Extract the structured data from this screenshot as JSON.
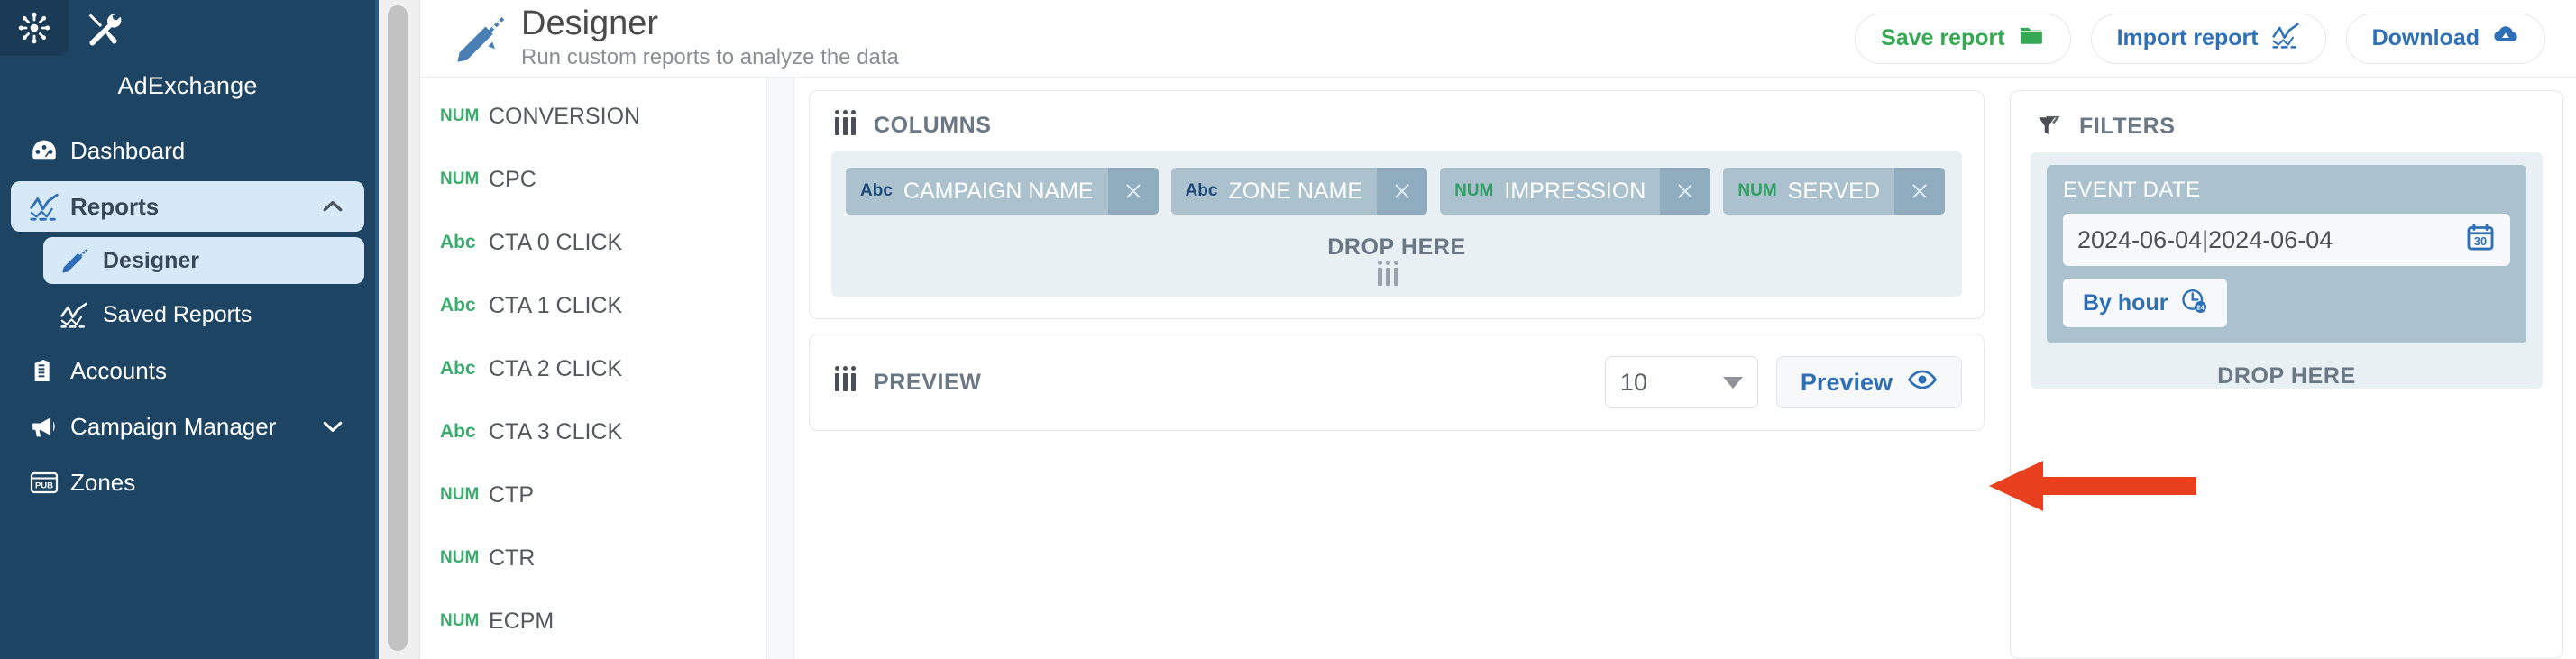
{
  "sidebar": {
    "brand": "AdExchange",
    "tabs": [
      {
        "name": "hub-tab",
        "icon": "asterisk-icon",
        "active": true
      },
      {
        "name": "tools-tab",
        "icon": "tools-icon",
        "active": false
      }
    ],
    "items": [
      {
        "label": "Dashboard",
        "icon": "dashboard-icon"
      },
      {
        "label": "Reports",
        "icon": "reports-chart-icon",
        "chevron": "chevron-up-icon",
        "active": true
      },
      {
        "label": "Designer",
        "icon": "designer-ruler-pen-icon",
        "sub": true,
        "active": true
      },
      {
        "label": "Saved Reports",
        "icon": "reports-chart-icon",
        "sub": true
      },
      {
        "label": "Accounts",
        "icon": "building-icon"
      },
      {
        "label": "Campaign Manager",
        "icon": "megaphone-icon",
        "chevron": "chevron-down-icon"
      },
      {
        "label": "Zones",
        "icon": "pub-window-icon"
      }
    ]
  },
  "header": {
    "icon": "designer-ruler-pen-icon",
    "title": "Designer",
    "subtitle": "Run custom reports to analyze the data",
    "actions": [
      {
        "label": "Save report",
        "icon": "folder-icon",
        "color": "#34a853"
      },
      {
        "label": "Import report",
        "icon": "chart-line-icon",
        "color": "#2f6fb5"
      },
      {
        "label": "Download",
        "icon": "cloud-download-icon",
        "color": "#2f6fb5"
      }
    ]
  },
  "field_list": [
    {
      "type": "NUM",
      "label": "CONVERSION"
    },
    {
      "type": "NUM",
      "label": "CPC"
    },
    {
      "type": "Abc",
      "label": "CTA 0 CLICK"
    },
    {
      "type": "Abc",
      "label": "CTA 1 CLICK"
    },
    {
      "type": "Abc",
      "label": "CTA 2 CLICK"
    },
    {
      "type": "Abc",
      "label": "CTA 3 CLICK"
    },
    {
      "type": "NUM",
      "label": "CTP"
    },
    {
      "type": "NUM",
      "label": "CTR"
    },
    {
      "type": "NUM",
      "label": "ECPM"
    }
  ],
  "columns_panel": {
    "title": "COLUMNS",
    "grip_icon": "drag-handle-icon",
    "chips": [
      {
        "type": "Abc",
        "label": "CAMPAIGN NAME",
        "remove_icon": "close-icon"
      },
      {
        "type": "Abc",
        "label": "ZONE NAME",
        "remove_icon": "close-icon"
      },
      {
        "type": "NUM",
        "label": "IMPRESSION",
        "remove_icon": "close-icon"
      },
      {
        "type": "NUM",
        "label": "SERVED",
        "remove_icon": "close-icon"
      }
    ],
    "drop_here": "DROP HERE"
  },
  "preview_panel": {
    "title": "PREVIEW",
    "grip_icon": "drag-handle-icon",
    "rows_value": "10",
    "rows_caret_icon": "chevron-down-icon",
    "preview_button": "Preview",
    "preview_icon": "eye-icon"
  },
  "filters_panel": {
    "title": "FILTERS",
    "icon": "funnel-icon",
    "filter_card": {
      "title": "EVENT DATE",
      "date_value": "2024-06-04|2024-06-04",
      "calendar_icon": "calendar-30-icon",
      "by_hour_label": "By hour",
      "by_hour_icon": "clock-24-icon"
    },
    "drop_here": "DROP HERE",
    "empty_icon": "funnel-icon"
  },
  "annotation": {
    "arrow_icon": "left-arrow-annotation",
    "color": "#e8401f"
  }
}
